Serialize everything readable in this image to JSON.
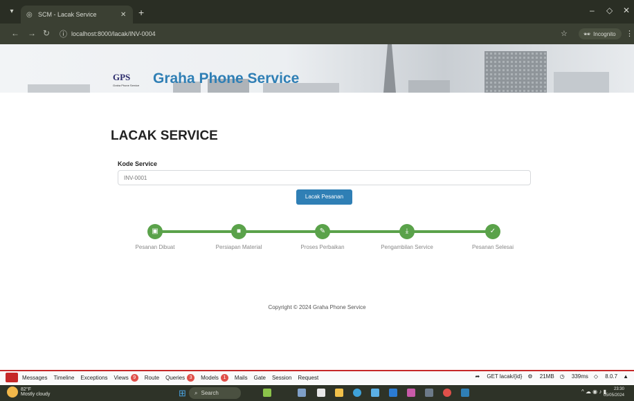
{
  "browser": {
    "tab_title": "SCM - Lacak Service",
    "new_tab": "+",
    "url": "localhost:8000/lacak/INV-0004",
    "incognito_label": "Incognito"
  },
  "page": {
    "logo_text": "GPS",
    "logo_sub": "Graha Phone Service",
    "brand": "Graha Phone Service",
    "heading": "LACAK SERVICE",
    "field_label": "Kode Service",
    "field_value": "INV-0001",
    "submit_label": "Lacak Pesanan",
    "steps": [
      {
        "label": "Pesanan Dibuat",
        "icon": "box-icon",
        "glyph": "▣"
      },
      {
        "label": "Persiapan Material",
        "icon": "package-icon",
        "glyph": "■"
      },
      {
        "label": "Proses Perbaikan",
        "icon": "wrench-icon",
        "glyph": "✎"
      },
      {
        "label": "Pengambilan Service",
        "icon": "download-icon",
        "glyph": "⤓"
      },
      {
        "label": "Pesanan Selesai",
        "icon": "check-icon",
        "glyph": "✓"
      }
    ],
    "copyright": "Copyright © 2024 Graha Phone Service"
  },
  "debugbar": {
    "items": [
      {
        "label": "Messages"
      },
      {
        "label": "Timeline"
      },
      {
        "label": "Exceptions"
      },
      {
        "label": "Views",
        "badge": "9"
      },
      {
        "label": "Route"
      },
      {
        "label": "Queries",
        "badge": "3"
      },
      {
        "label": "Models",
        "badge": "1"
      },
      {
        "label": "Mails"
      },
      {
        "label": "Gate"
      },
      {
        "label": "Session"
      },
      {
        "label": "Request"
      }
    ],
    "request": "GET lacak/{id}",
    "memory": "21MB",
    "time": "339ms",
    "version": "8.0.7"
  },
  "taskbar": {
    "temperature": "82°F",
    "weather": "Mostly cloudy",
    "search": "Search",
    "time": "23:30",
    "date": "05/05/2024"
  },
  "colors": {
    "brand_blue": "#2f7fb5",
    "step_green": "#5aa24a",
    "debug_red": "#c62828"
  }
}
